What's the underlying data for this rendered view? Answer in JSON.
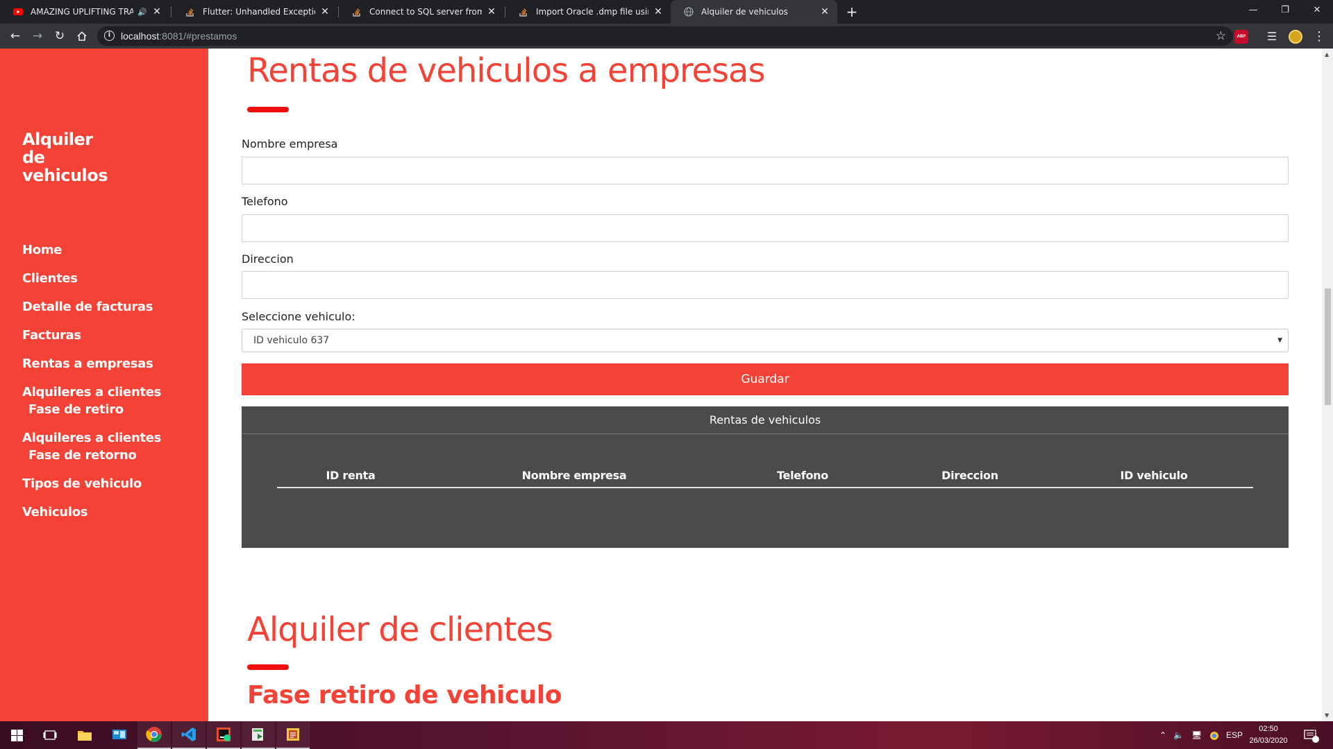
{
  "browser": {
    "tabs": [
      {
        "label": "AMAZING UPLIFTING TRANC",
        "active": false,
        "icon": "youtube-icon",
        "audio": true
      },
      {
        "label": "Flutter: Unhandled Exception: Se",
        "active": false,
        "icon": "stackoverflow-icon"
      },
      {
        "label": "Connect to SQL server from PHP",
        "active": false,
        "icon": "stackoverflow-icon"
      },
      {
        "label": "Import Oracle .dmp file using SQ",
        "active": false,
        "icon": "stackoverflow-icon"
      },
      {
        "label": "Alquiler de vehiculos",
        "active": true,
        "icon": "globe-icon"
      }
    ],
    "url_host": "localhost",
    "url_rest": ":8081/#prestamos",
    "extension_abp": "ABP"
  },
  "sidebar": {
    "brand": [
      "Alquiler",
      "de",
      "vehiculos"
    ],
    "items": [
      {
        "label": "Home"
      },
      {
        "label": "Clientes"
      },
      {
        "label": "Detalle de facturas"
      },
      {
        "label": "Facturas"
      },
      {
        "label": "Rentas a empresas"
      },
      {
        "label": "Alquileres a clientes",
        "sub": "Fase de retiro"
      },
      {
        "label": "Alquileres a clientes",
        "sub": "Fase de retorno"
      },
      {
        "label": "Tipos de vehiculo"
      },
      {
        "label": "Vehiculos"
      }
    ]
  },
  "main": {
    "title": "Rentas de vehiculos a empresas",
    "form": {
      "nombre_label": "Nombre empresa",
      "nombre_value": "",
      "telefono_label": "Telefono",
      "telefono_value": "",
      "direccion_label": "Direccion",
      "direccion_value": "",
      "vehiculo_label": "Seleccione vehiculo:",
      "vehiculo_selected": "ID vehiculo 637",
      "save_label": "Guardar"
    },
    "table": {
      "caption": "Rentas de vehiculos",
      "headers": [
        "ID renta",
        "Nombre empresa",
        "Telefono",
        "Direccion",
        "ID vehiculo"
      ],
      "rows": []
    },
    "section2_title": "Alquiler de clientes",
    "section2_subtitle": "Fase retiro de vehiculo"
  },
  "taskbar": {
    "language": "ESP",
    "time": "02:50",
    "date": "26/03/2020",
    "notifications": "1"
  },
  "colors": {
    "accent": "#f44336",
    "table_bg": "#4b4b4b",
    "chrome_dark": "#202124",
    "chrome_toolbar": "#35363a"
  }
}
